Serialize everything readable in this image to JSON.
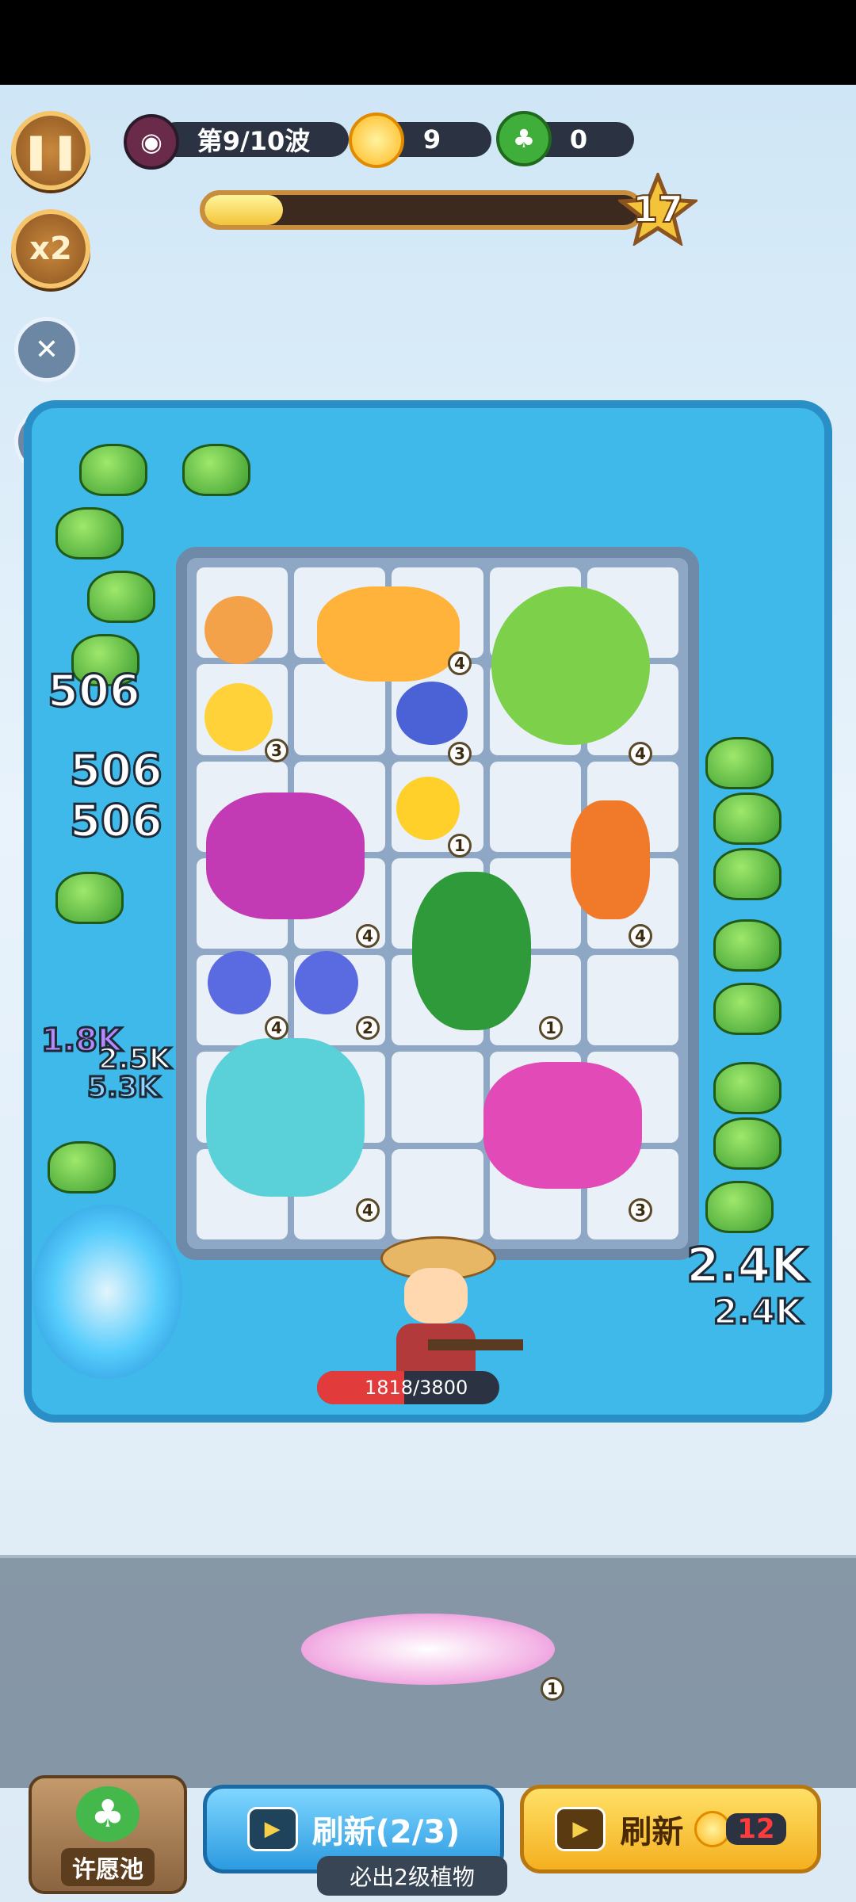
{
  "hud": {
    "wave_label": "第9/10波",
    "sun_count": "9",
    "clover_count": "0",
    "stage_level": "17",
    "wave_progress": 0.18
  },
  "left_buttons": {
    "speed_label": "x2"
  },
  "board": {
    "unit_levels": [
      "4",
      "3",
      "3",
      "4",
      "1",
      "4",
      "4",
      "2",
      "1",
      "4",
      "4",
      "3"
    ]
  },
  "damage_numbers": {
    "left": [
      "506",
      "506",
      "506",
      "1.8K",
      "2.5K",
      "5.3K"
    ],
    "right": [
      "2.4K",
      "2.4K"
    ]
  },
  "hero": {
    "hp_text": "1818/3800",
    "hp_current": 1818,
    "hp_max": 3800
  },
  "bench": {
    "unit_level": "1"
  },
  "bottom": {
    "wish_label": "许愿池",
    "refresh_free_label": "刷新(2/3)",
    "refresh_hint": "必出2级植物",
    "refresh_paid_label": "刷新",
    "refresh_cost": "12"
  },
  "colors": {
    "accent_gold": "#f5c46b",
    "pool_blue": "#3fb9e9",
    "hp_red": "#e23b3b",
    "slime_green": "#3b9c2e"
  }
}
